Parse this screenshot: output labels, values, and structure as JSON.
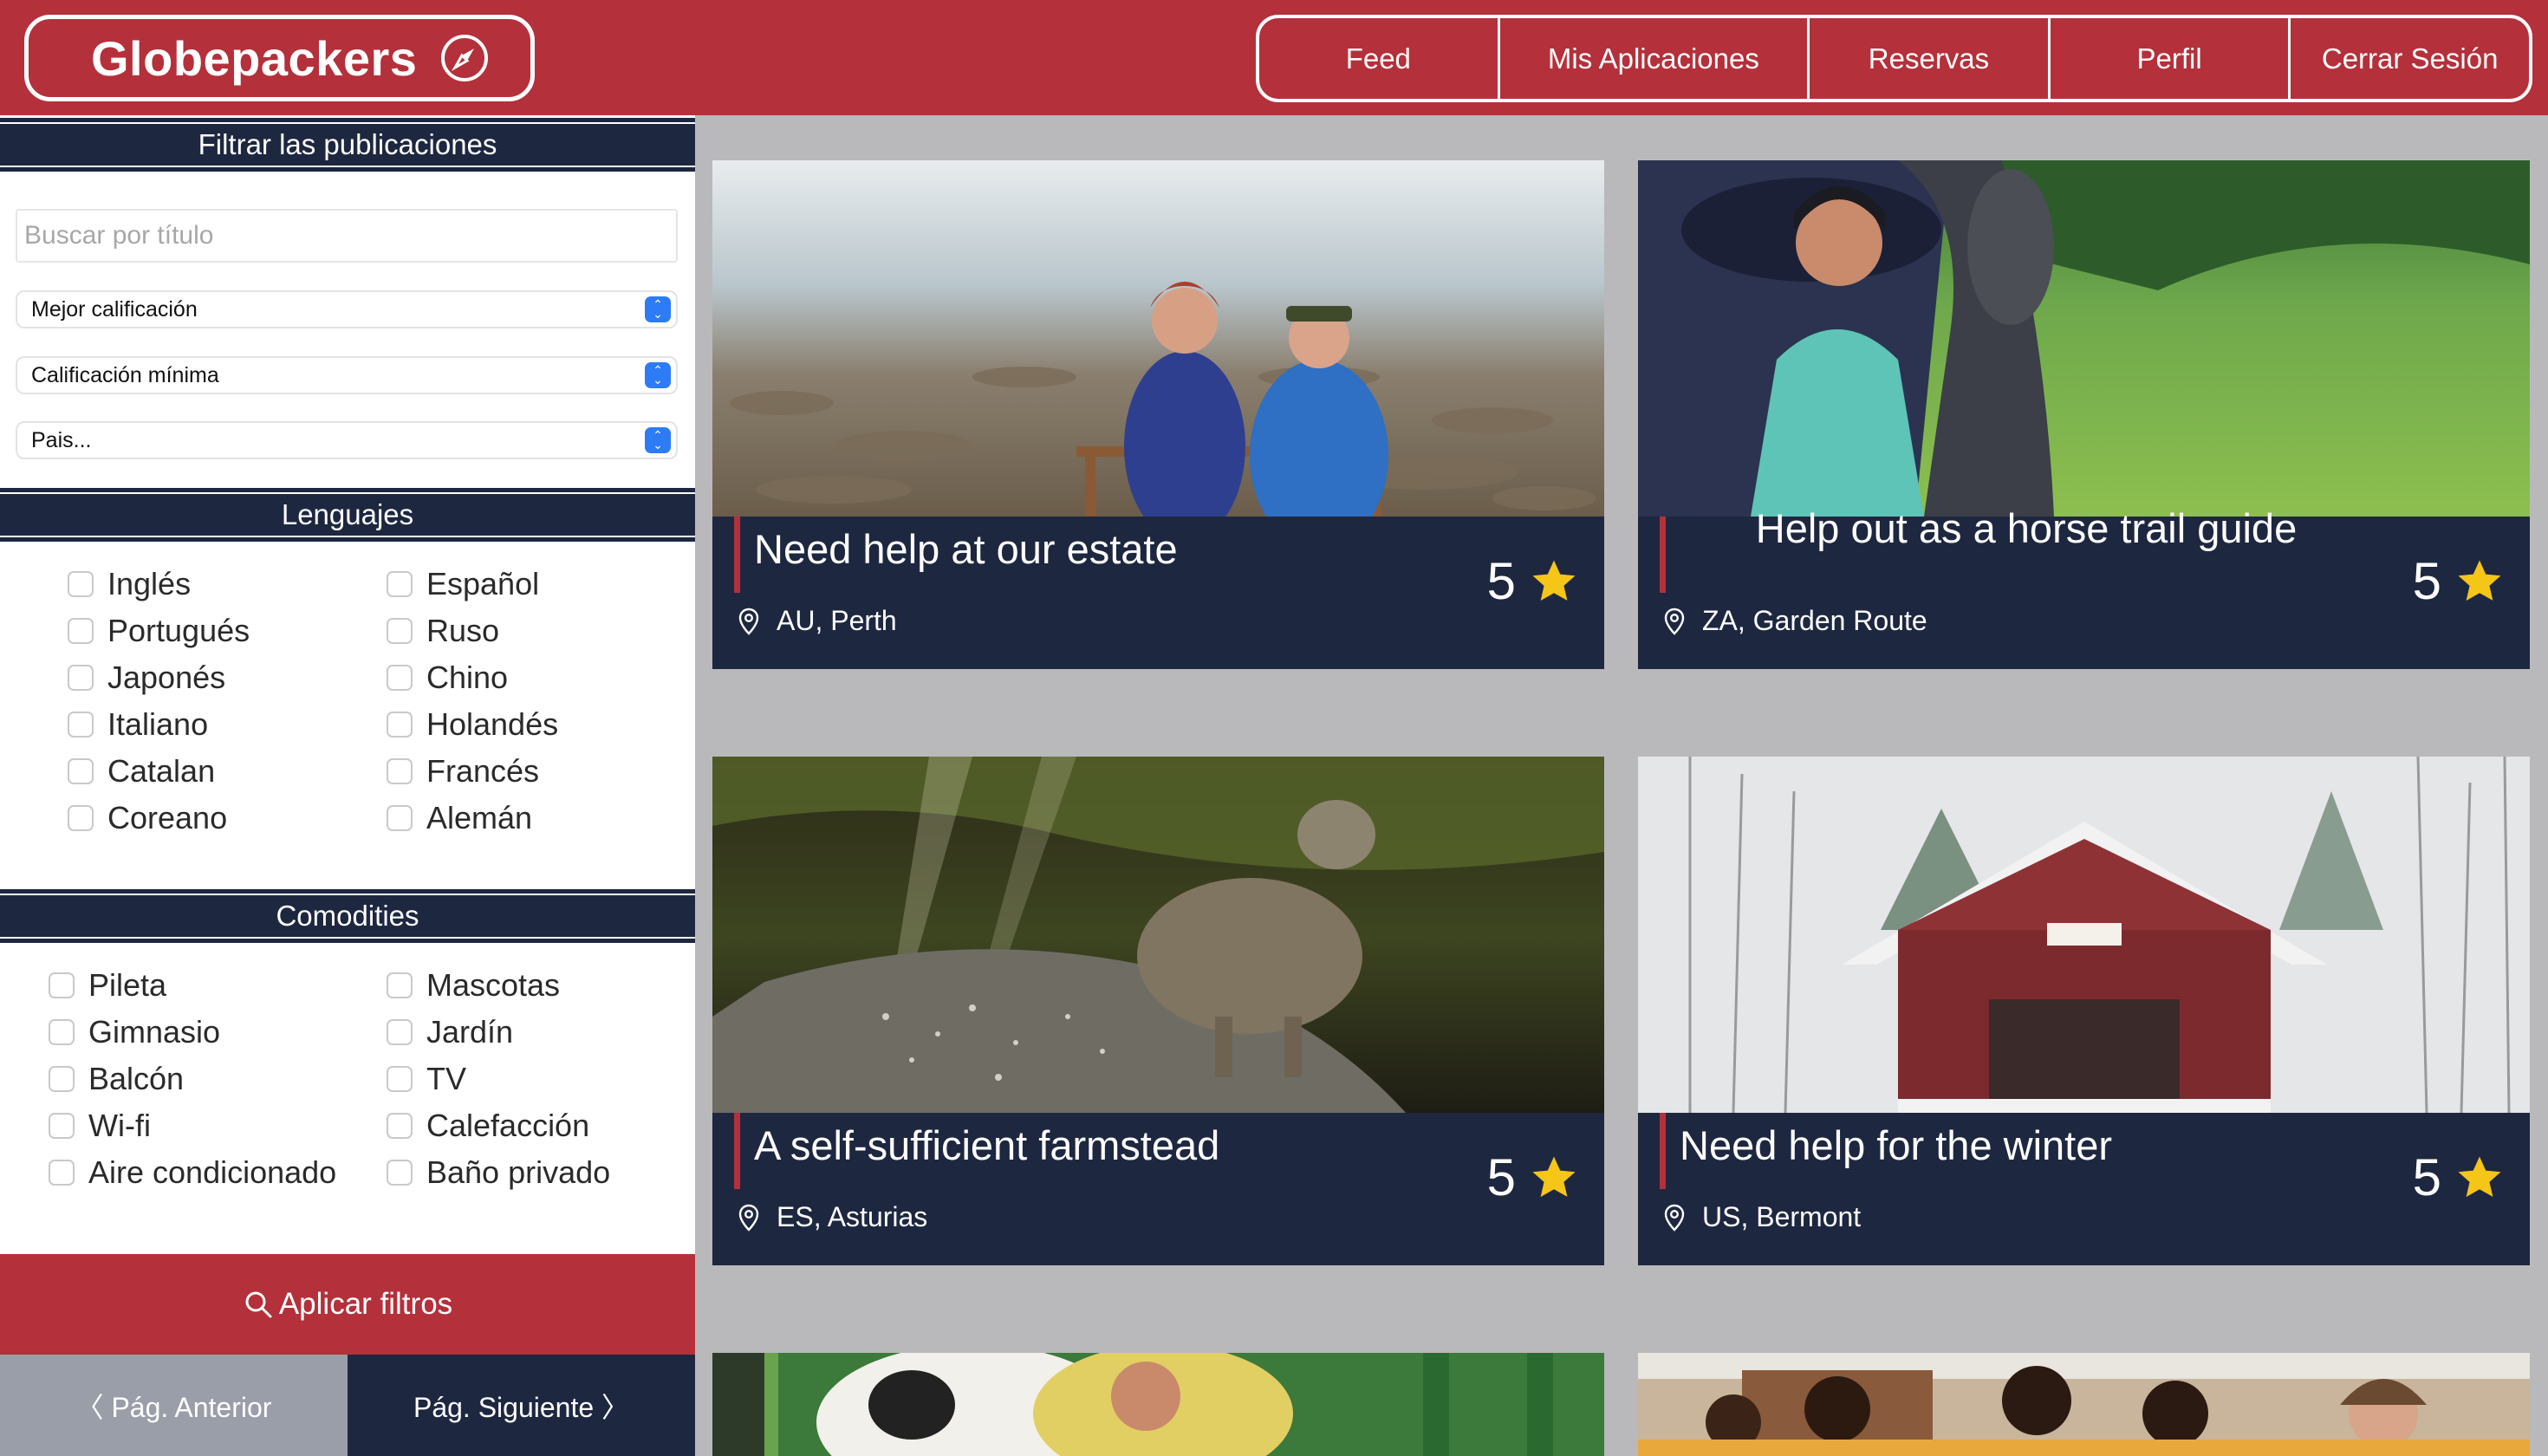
{
  "header": {
    "brand": "Globepackers",
    "nav": [
      "Feed",
      "Mis Aplicaciones",
      "Reservas",
      "Perfil",
      "Cerrar Sesión"
    ]
  },
  "filters": {
    "title": "Filtrar las publicaciones",
    "search_placeholder": "Buscar por título",
    "sort_select": "Mejor calificación",
    "rating_select": "Calificación mínima",
    "country_select": "Pais..."
  },
  "languages": {
    "title": "Lenguajes",
    "items": [
      "Inglés",
      "Español",
      "Portugués",
      "Ruso",
      "Japonés",
      "Chino",
      "Italiano",
      "Holandés",
      "Catalan",
      "Francés",
      "Coreano",
      "Alemán"
    ]
  },
  "amenities": {
    "title": "Comodities",
    "items": [
      "Pileta",
      "Mascotas",
      "Gimnasio",
      "Jardín",
      "Balcón",
      "TV",
      "Wi-fi",
      "Calefacción",
      "Aire condicionado",
      "Baño privado"
    ]
  },
  "actions": {
    "apply": "Aplicar filtros",
    "prev_page": "〈 Pág. Anterior",
    "next_page": "Pág. Siguiente 〉"
  },
  "posts": [
    {
      "title": "Need help at our estate",
      "location": "AU, Perth",
      "rating": "5"
    },
    {
      "title": "Help out as a horse trail guide",
      "location": "ZA, Garden Route",
      "rating": "5"
    },
    {
      "title": "A self-sufficient farmstead",
      "location": "ES, Asturias",
      "rating": "5"
    },
    {
      "title": "Need help for the winter",
      "location": "US, Bermont",
      "rating": "5"
    }
  ],
  "colors": {
    "brand_red": "#b4303a",
    "navy": "#1e2740",
    "star": "#f5c518",
    "page_bg": "#b9b9bc"
  }
}
